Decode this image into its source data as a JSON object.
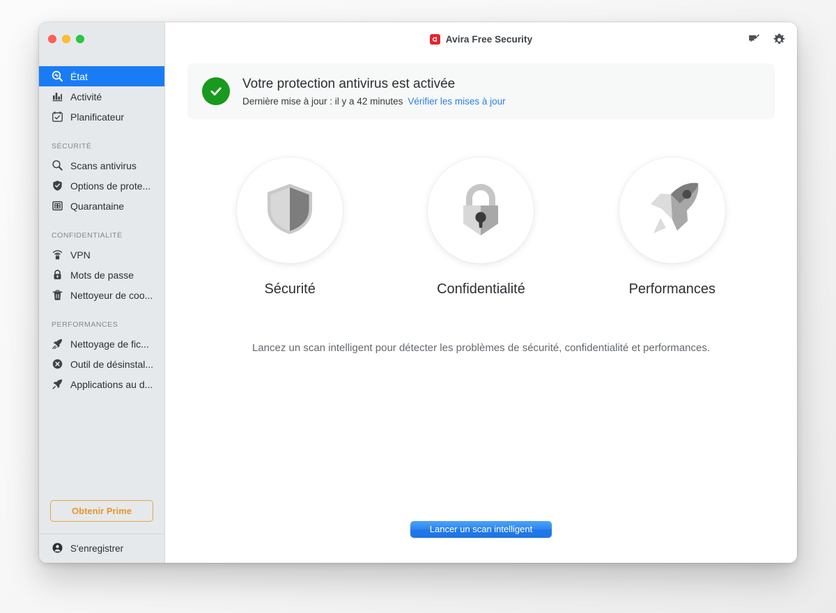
{
  "window": {
    "traffic_lights": [
      {
        "name": "close",
        "color": "#ff5f57"
      },
      {
        "name": "minimize",
        "color": "#febc2e"
      },
      {
        "name": "zoom",
        "color": "#28c840"
      }
    ]
  },
  "titlebar": {
    "app_name": "Avira Free Security",
    "logo_icon": "avira-logo-icon",
    "actions": [
      {
        "icon": "feedback-edit-icon",
        "name": "feedback-button"
      },
      {
        "icon": "gear-icon",
        "name": "settings-button"
      }
    ]
  },
  "sidebar": {
    "groups": [
      {
        "title": null,
        "items": [
          {
            "label": "État",
            "icon": "status-magnifier-icon",
            "selected": true
          },
          {
            "label": "Activité",
            "icon": "bar-chart-icon",
            "selected": false
          },
          {
            "label": "Planificateur",
            "icon": "calendar-check-icon",
            "selected": false
          }
        ]
      },
      {
        "title": "SÉCURITÉ",
        "items": [
          {
            "label": "Scans antivirus",
            "icon": "magnifier-icon",
            "selected": false
          },
          {
            "label": "Options de prote...",
            "icon": "shield-check-icon",
            "selected": false
          },
          {
            "label": "Quarantaine",
            "icon": "quarantine-box-icon",
            "selected": false
          }
        ]
      },
      {
        "title": "CONFIDENTIALITÉ",
        "items": [
          {
            "label": "VPN",
            "icon": "vpn-signal-lock-icon",
            "selected": false
          },
          {
            "label": "Mots de passe",
            "icon": "padlock-icon",
            "selected": false
          },
          {
            "label": "Nettoyeur de coo...",
            "icon": "trash-icon",
            "selected": false
          }
        ]
      },
      {
        "title": "PERFORMANCES",
        "items": [
          {
            "label": "Nettoyage de fic...",
            "icon": "rocket-broom-icon",
            "selected": false
          },
          {
            "label": "Outil de désinstal...",
            "icon": "x-circle-icon",
            "selected": false
          },
          {
            "label": "Applications au d...",
            "icon": "rocket-icon",
            "selected": false
          }
        ]
      }
    ],
    "premium_button": "Obtenir Prime",
    "register": {
      "label": "S'enregistrer",
      "icon": "account-circle-icon"
    }
  },
  "status": {
    "icon": "green-check-circle-icon",
    "title": "Votre protection antivirus est activée",
    "subtitle": "Dernière mise à jour : il y a 42 minutes",
    "link": "Vérifier les mises à jour",
    "accent_color": "#179a1d",
    "link_color": "#2b7de9"
  },
  "features": [
    {
      "label": "Sécurité",
      "icon": "shield-icon"
    },
    {
      "label": "Confidentialité",
      "icon": "padlock-large-icon"
    },
    {
      "label": "Performances",
      "icon": "rocket-large-icon"
    }
  ],
  "tagline": "Lancez un scan intelligent pour détecter les problèmes de sécurité, confidentialité et performances.",
  "cta": {
    "label": "Lancer un scan intelligent",
    "color": "#2179e8"
  }
}
